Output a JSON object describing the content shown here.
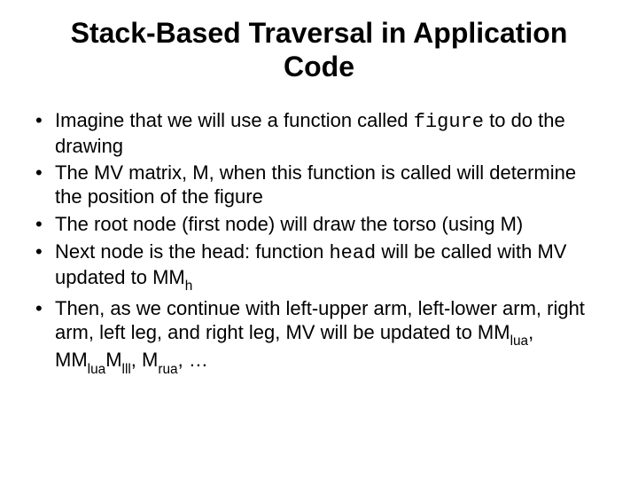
{
  "title": "Stack-Based Traversal in Application Code",
  "b1a": "Imagine that we will use a function called ",
  "b1code": "figure",
  "b1b": " to do the drawing",
  "b2": "The MV matrix, M, when this function is called will determine the position of the figure",
  "b3": "The root node (first node) will draw the torso (using M)",
  "b4a": "Next node is the head: function ",
  "b4code": "head",
  "b4b": " will be called with MV updated to MM",
  "b4sub": "h",
  "b5a": "Then, as we continue with left-upper arm, left-lower arm, right arm, left leg, and right leg, MV will be updated to MM",
  "b5s1": "lua",
  "b5m1": ", MM",
  "b5s2": "lua",
  "b5m2": "M",
  "b5s3": "lll",
  "b5m3": ", M",
  "b5s4": "rua",
  "b5end": ", …"
}
